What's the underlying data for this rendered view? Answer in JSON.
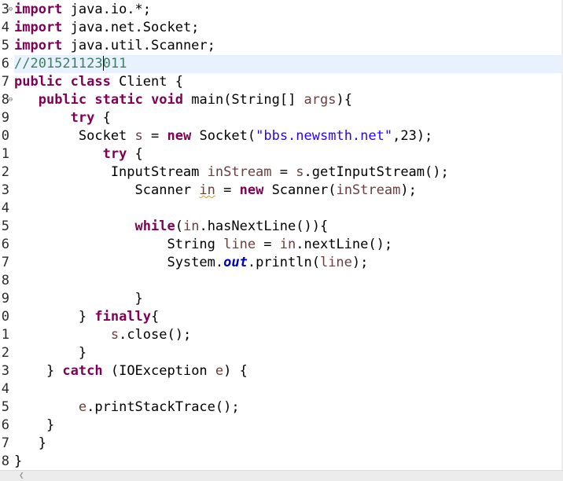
{
  "editor": {
    "line_numbers": [
      "3",
      "4",
      "5",
      "6",
      "7",
      "8",
      "9",
      "0",
      "1",
      "2",
      "3",
      "4",
      "5",
      "6",
      "7",
      "8",
      "9",
      "0",
      "1",
      "2",
      "3",
      "4",
      "5",
      "6",
      "7",
      "8"
    ],
    "fold_markers": {
      "0": "⊖",
      "5": "⊖"
    },
    "current_line_index": 3,
    "lines": [
      [
        {
          "t": "import",
          "c": "kw"
        },
        {
          "t": " java.io.*;"
        }
      ],
      [
        {
          "t": "import",
          "c": "kw"
        },
        {
          "t": " java.net.Socket;"
        }
      ],
      [
        {
          "t": "import",
          "c": "kw"
        },
        {
          "t": " java.util.Scanner;"
        }
      ],
      [
        {
          "t": "//201521123",
          "c": "cm"
        },
        {
          "caret": true
        },
        {
          "t": "011",
          "c": "cm"
        }
      ],
      [
        {
          "t": "public",
          "c": "kw"
        },
        {
          "t": " "
        },
        {
          "t": "class",
          "c": "kw"
        },
        {
          "t": " Client {"
        }
      ],
      [
        {
          "t": "   "
        },
        {
          "t": "public",
          "c": "kw"
        },
        {
          "t": " "
        },
        {
          "t": "static",
          "c": "kw"
        },
        {
          "t": " "
        },
        {
          "t": "void",
          "c": "kw"
        },
        {
          "t": " main(String[] "
        },
        {
          "t": "args",
          "c": "var"
        },
        {
          "t": "){"
        }
      ],
      [
        {
          "t": "       "
        },
        {
          "t": "try",
          "c": "kw"
        },
        {
          "t": " {"
        }
      ],
      [
        {
          "t": "        Socket "
        },
        {
          "t": "s",
          "c": "var"
        },
        {
          "t": " = "
        },
        {
          "t": "new",
          "c": "kw"
        },
        {
          "t": " Socket("
        },
        {
          "t": "\"bbs.newsmth.net\"",
          "c": "str"
        },
        {
          "t": ",23);"
        }
      ],
      [
        {
          "t": "           "
        },
        {
          "t": "try",
          "c": "kw"
        },
        {
          "t": " {"
        }
      ],
      [
        {
          "t": "            InputStream "
        },
        {
          "t": "inStream",
          "c": "var"
        },
        {
          "t": " = "
        },
        {
          "t": "s",
          "c": "var"
        },
        {
          "t": ".getInputStream();"
        }
      ],
      [
        {
          "t": "               Scanner "
        },
        {
          "t": "in",
          "c": "var squig"
        },
        {
          "t": " = "
        },
        {
          "t": "new",
          "c": "kw"
        },
        {
          "t": " Scanner("
        },
        {
          "t": "inStream",
          "c": "var"
        },
        {
          "t": ");"
        }
      ],
      [
        {
          "t": ""
        }
      ],
      [
        {
          "t": "               "
        },
        {
          "t": "while",
          "c": "kw"
        },
        {
          "t": "("
        },
        {
          "t": "in",
          "c": "var"
        },
        {
          "t": ".hasNextLine()){"
        }
      ],
      [
        {
          "t": "                   String "
        },
        {
          "t": "line",
          "c": "var"
        },
        {
          "t": " = "
        },
        {
          "t": "in",
          "c": "var"
        },
        {
          "t": ".nextLine();"
        }
      ],
      [
        {
          "t": "                   System."
        },
        {
          "t": "out",
          "c": "fld"
        },
        {
          "t": ".println("
        },
        {
          "t": "line",
          "c": "var"
        },
        {
          "t": ");"
        }
      ],
      [
        {
          "t": ""
        }
      ],
      [
        {
          "t": "               }"
        }
      ],
      [
        {
          "t": "        } "
        },
        {
          "t": "finally",
          "c": "kw"
        },
        {
          "t": "{"
        }
      ],
      [
        {
          "t": "            "
        },
        {
          "t": "s",
          "c": "var"
        },
        {
          "t": ".close();"
        }
      ],
      [
        {
          "t": "        }"
        }
      ],
      [
        {
          "t": "    } "
        },
        {
          "t": "catch",
          "c": "kw"
        },
        {
          "t": " (IOException "
        },
        {
          "t": "e",
          "c": "var"
        },
        {
          "t": ") {"
        }
      ],
      [
        {
          "t": ""
        }
      ],
      [
        {
          "t": "        "
        },
        {
          "t": "e",
          "c": "var"
        },
        {
          "t": ".printStackTrace();"
        }
      ],
      [
        {
          "t": "    }"
        }
      ],
      [
        {
          "t": "   }"
        }
      ],
      [
        {
          "t": "}"
        }
      ]
    ]
  },
  "colors": {
    "keyword": "#7f0055",
    "string": "#2a00ff",
    "comment": "#3f7f5f",
    "local_variable": "#6a3e3e",
    "static_field": "#0000c0",
    "current_line_bg": "#e8f2fe"
  },
  "scrollbar": {
    "left_arrow_icon": "chevron-left-icon"
  }
}
